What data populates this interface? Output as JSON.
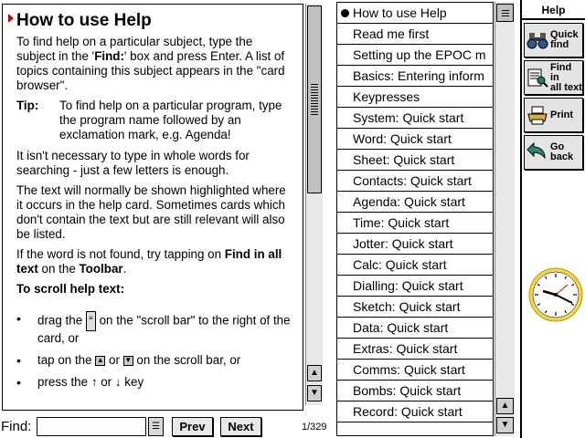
{
  "help": {
    "title": "How to use Help",
    "p1_a": "To find help on a particular subject, type the subject in the '",
    "p1_find": "Find:",
    "p1_b": "' box and press Enter. A list of topics containing this subject appears in the \"card browser\".",
    "tip_label": "Tip:",
    "tip_text": "To find help on a particular program, type the program name followed by an exclamation mark, e.g. Agenda!",
    "p2": "It isn't necessary to type in whole words for searching - just a few letters is enough.",
    "p3": "The text will normally be shown highlighted where it occurs in the help card. Sometimes cards which don't contain the text but are still relevant will also be listed.",
    "p4_a": "If the word is not found, try tapping on ",
    "p4_b": "Find in all text",
    "p4_c": " on the ",
    "p4_d": "Toolbar",
    "p4_e": ".",
    "section": "To scroll help text:",
    "b1_a": "drag the ",
    "b1_b": " on the \"scroll bar\" to the right of the card, or",
    "b2_a": "tap on the ",
    "b2_b": " or ",
    "b2_c": " on the scroll bar, or",
    "b3_a": "press the ",
    "b3_b": " or ",
    "b3_c": " key",
    "bullet_char": "•",
    "up_glyph": "▲",
    "down_glyph": "▼",
    "up_arrow": "↑",
    "down_arrow": "↓"
  },
  "find_bar": {
    "label": "Find:",
    "value": "",
    "prev": "Prev",
    "next": "Next",
    "count": "1/329"
  },
  "cards": [
    "How to use Help",
    "Read me first",
    "Setting up the EPOC m",
    "Basics: Entering inform",
    "Keypresses",
    "System: Quick start",
    "Word: Quick start",
    "Sheet: Quick start",
    "Contacts: Quick start",
    "Agenda: Quick start",
    "Time: Quick start",
    "Jotter: Quick start",
    "Calc: Quick start",
    "Dialling: Quick start",
    "Sketch: Quick start",
    "Data: Quick start",
    "Extras: Quick start",
    "Comms: Quick start",
    "Bombs: Quick start",
    "Record: Quick start"
  ],
  "selected_card": 0,
  "toolbar": {
    "title": "Help",
    "quick_find_1": "Quick",
    "quick_find_2": "find",
    "find_all_1": "Find in",
    "find_all_2": "all text",
    "print": "Print",
    "go_back": "Go back",
    "icons": [
      "binoculars-icon",
      "find-all-icon",
      "printer-icon",
      "go-back-icon",
      "clock-icon"
    ]
  },
  "colors": {
    "title_triangle": "#cc0000",
    "clock_rim": "#e8c200",
    "clock_face": "#ffffff"
  }
}
